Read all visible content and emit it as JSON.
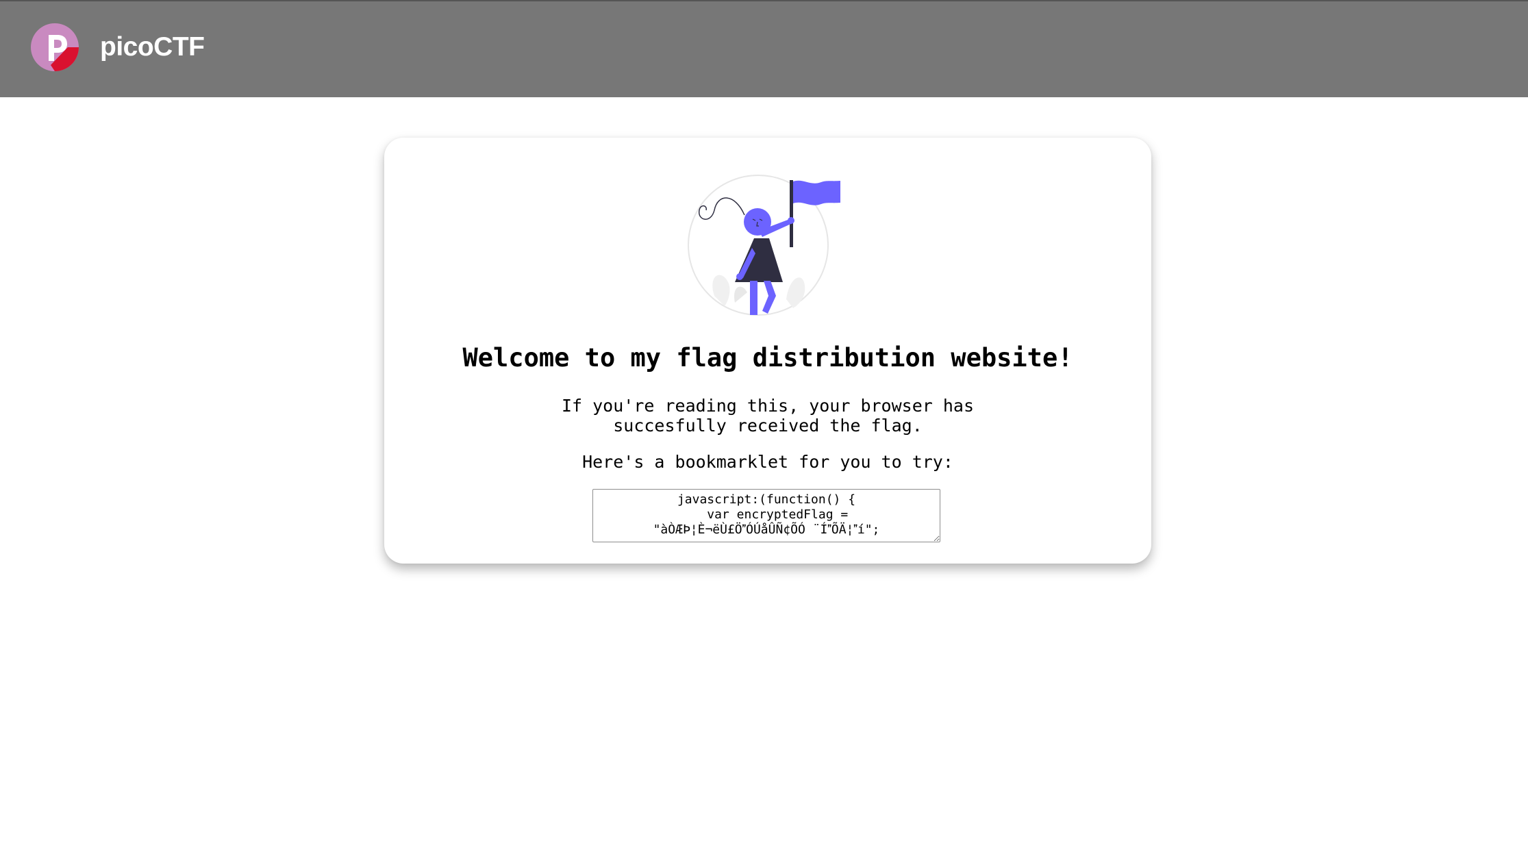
{
  "navbar": {
    "brand": "picoCTF",
    "logo_icon": "picoctf-logo-icon",
    "background": "#777777"
  },
  "card": {
    "illustration_icon": "person-with-flag-illustration",
    "title": "Welcome to my flag distribution website!",
    "paragraph_1_line_1": "If you're reading this, your browser has",
    "paragraph_1_line_2": "succesfully received the flag.",
    "paragraph_2": "Here's a bookmarklet for you to try:",
    "bookmarklet_code": "javascript:(function() {\n    var encryptedFlag = \n\"àÒÆÞ¦È¬ëÙ£ÖÓÚåÛÑ¢ÕÓ¨ÍÕÄ¦í\";"
  },
  "colors": {
    "accent": "#6c63ff",
    "dark_figure": "#2f2e41",
    "logo_pink": "#c77dba",
    "logo_red": "#d9112f"
  }
}
